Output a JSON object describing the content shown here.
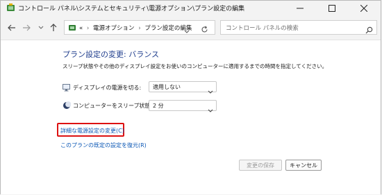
{
  "window": {
    "title": "コントロール パネル\\システムとセキュリティ\\電源オプション\\プラン設定の編集",
    "minimize_icon": "minimize-icon",
    "maximize_icon": "maximize-icon",
    "close_icon": "close-icon"
  },
  "nav": {
    "back_icon": "arrow-left-icon",
    "forward_icon": "arrow-right-icon",
    "recent_icon": "chevron-down-icon",
    "up_icon": "arrow-up-icon"
  },
  "address": {
    "overflow": "«",
    "crumbs": [
      "電源オプション",
      "プラン設定の編集"
    ],
    "separator": "›"
  },
  "search": {
    "placeholder": "コントロール パネルの検索"
  },
  "content": {
    "heading": "プラン設定の変更: バランス",
    "description": "スリープ状態やその他のディスプレイ設定をお使いのコンピューターに適用するまでの時間を指定してください。",
    "display_off": {
      "label": "ディスプレイの電源を切る:",
      "value": "適用しない"
    },
    "sleep": {
      "label": "コンピューターをスリープ状態にする:",
      "value": "2 分"
    },
    "advanced_link": "詳細な電源設定の変更(C)",
    "restore_link": "このプランの既定の設定を復元(R)"
  },
  "buttons": {
    "save": "変更の保存",
    "cancel": "キャンセル"
  },
  "colors": {
    "heading": "#1e3c8c",
    "link": "#0b57b5",
    "highlight": "#dd1111"
  }
}
